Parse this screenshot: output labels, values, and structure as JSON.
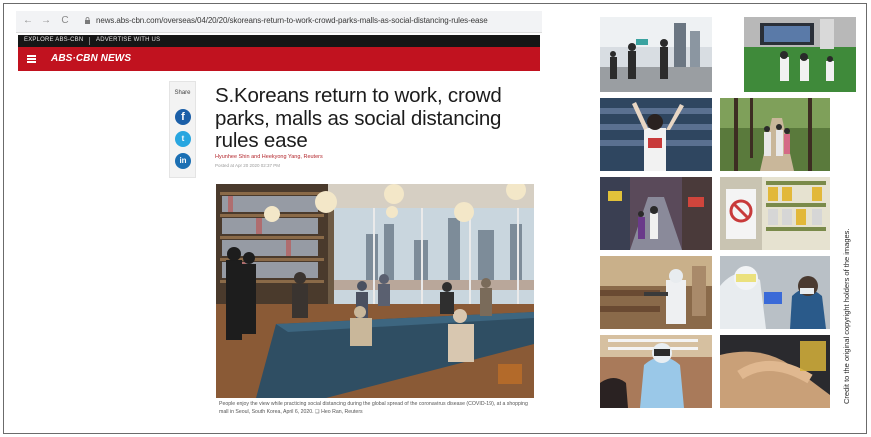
{
  "browser": {
    "url": "news.abs-cbn.com/overseas/04/20/20/skoreans-return-to-work-crowd-parks-malls-as-social-distancing-rules-ease",
    "nav_back": "←",
    "nav_forward": "→",
    "nav_reload": "C"
  },
  "site": {
    "topnav": [
      "EXPLORE ABS-CBN",
      "ADVERTISE WITH US"
    ],
    "brand": "ABS·CBN NEWS",
    "menu_icon": "hamburger-icon"
  },
  "share": {
    "label": "Share",
    "buttons": [
      {
        "icon": "facebook-icon",
        "glyph": "f",
        "color": "#1b5fa8"
      },
      {
        "icon": "twitter-icon",
        "glyph": "t",
        "color": "#28a6e0"
      },
      {
        "icon": "linkedin-icon",
        "glyph": "in",
        "color": "#1b6fb3"
      }
    ]
  },
  "article": {
    "headline": "S.Koreans return to work, crowd parks, malls as social distancing rules ease",
    "byline": "Hyunhee Shin and Heekyong Yang, Reuters",
    "posted": "Posted at Apr 20 2020 02:37 PM",
    "caption": "People enjoy the view while practicing social distancing during the global spread of the coronavirus disease (COVID-19), at a shopping mall in Seoul, South Korea, April 6, 2020.  ❑ Heo Ran, Reuters"
  },
  "gallery": {
    "credit": "Credit to the original copyright holders of the images."
  },
  "colors": {
    "brand_red": "#c1121f",
    "topnav_bg": "#161616",
    "byline_red": "#b3272d"
  }
}
